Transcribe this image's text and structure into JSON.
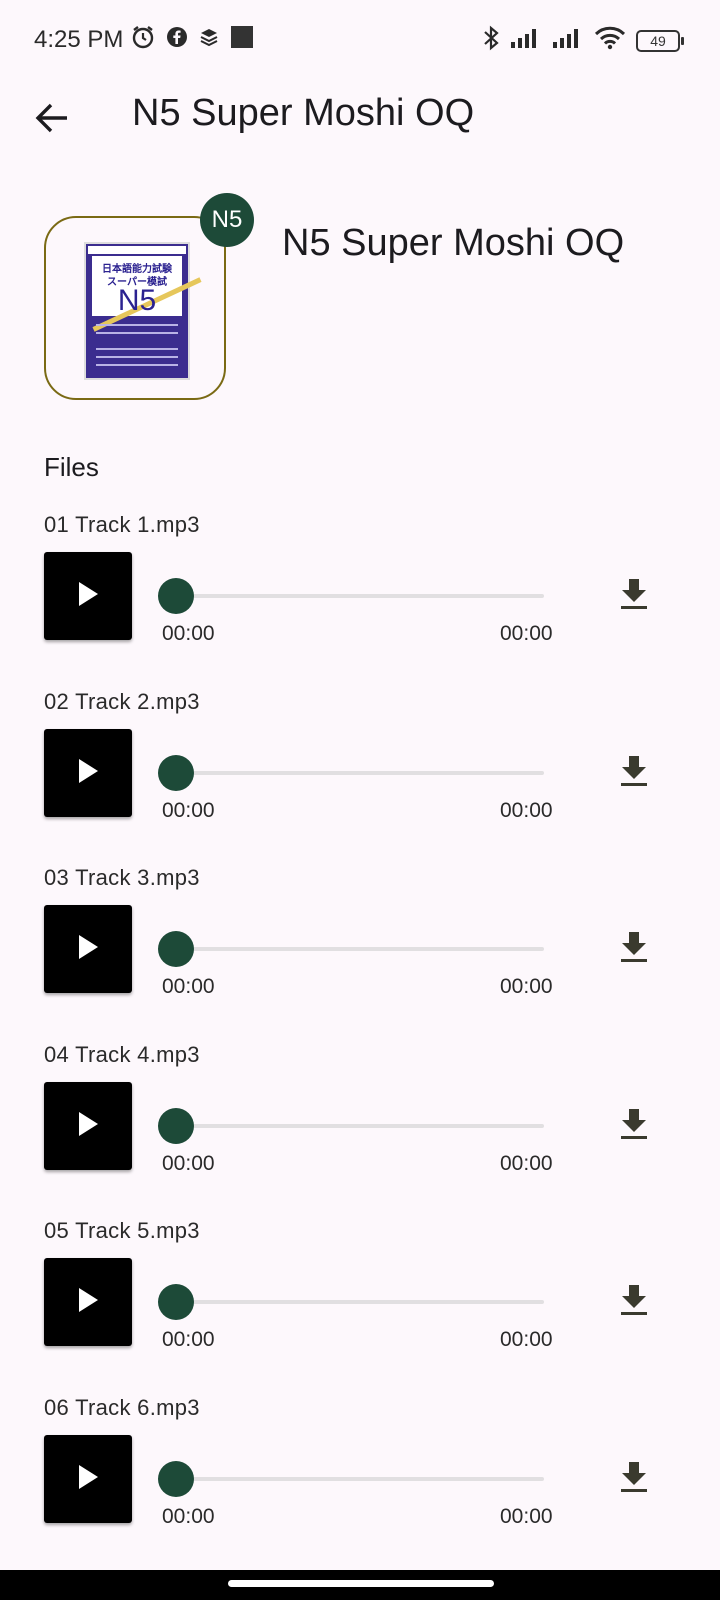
{
  "status_bar": {
    "time": "4:25 PM",
    "battery": "49",
    "left_icons": [
      "alarm-icon",
      "facebook-icon",
      "layers-icon",
      "square-icon"
    ],
    "right_icons": [
      "bluetooth-icon",
      "signal-icon",
      "signal-icon",
      "wifi-icon",
      "battery-icon"
    ]
  },
  "app_bar": {
    "title": "N5 Super Moshi OQ",
    "back_icon": "arrow-left-icon"
  },
  "header": {
    "title": "N5 Super Moshi OQ",
    "badge": "N5",
    "cover": {
      "title_jp_line1": "日本語能力試験",
      "title_jp_line2": "スーパー模試",
      "level": "N5"
    },
    "colors": {
      "accent": "#1d4a38",
      "cover_border": "#7a6a14",
      "cover_bg": "#3b2d8f"
    }
  },
  "files": {
    "heading": "Files",
    "tracks": [
      {
        "name": "01 Track 1.mp3",
        "current": "00:00",
        "duration": "00:00",
        "progress": 0
      },
      {
        "name": "02 Track 2.mp3",
        "current": "00:00",
        "duration": "00:00",
        "progress": 0
      },
      {
        "name": "03 Track 3.mp3",
        "current": "00:00",
        "duration": "00:00",
        "progress": 0
      },
      {
        "name": "04 Track 4.mp3",
        "current": "00:00",
        "duration": "00:00",
        "progress": 0
      },
      {
        "name": "05 Track 5.mp3",
        "current": "00:00",
        "duration": "00:00",
        "progress": 0
      },
      {
        "name": "06 Track 6.mp3",
        "current": "00:00",
        "duration": "00:00",
        "progress": 0
      }
    ]
  }
}
